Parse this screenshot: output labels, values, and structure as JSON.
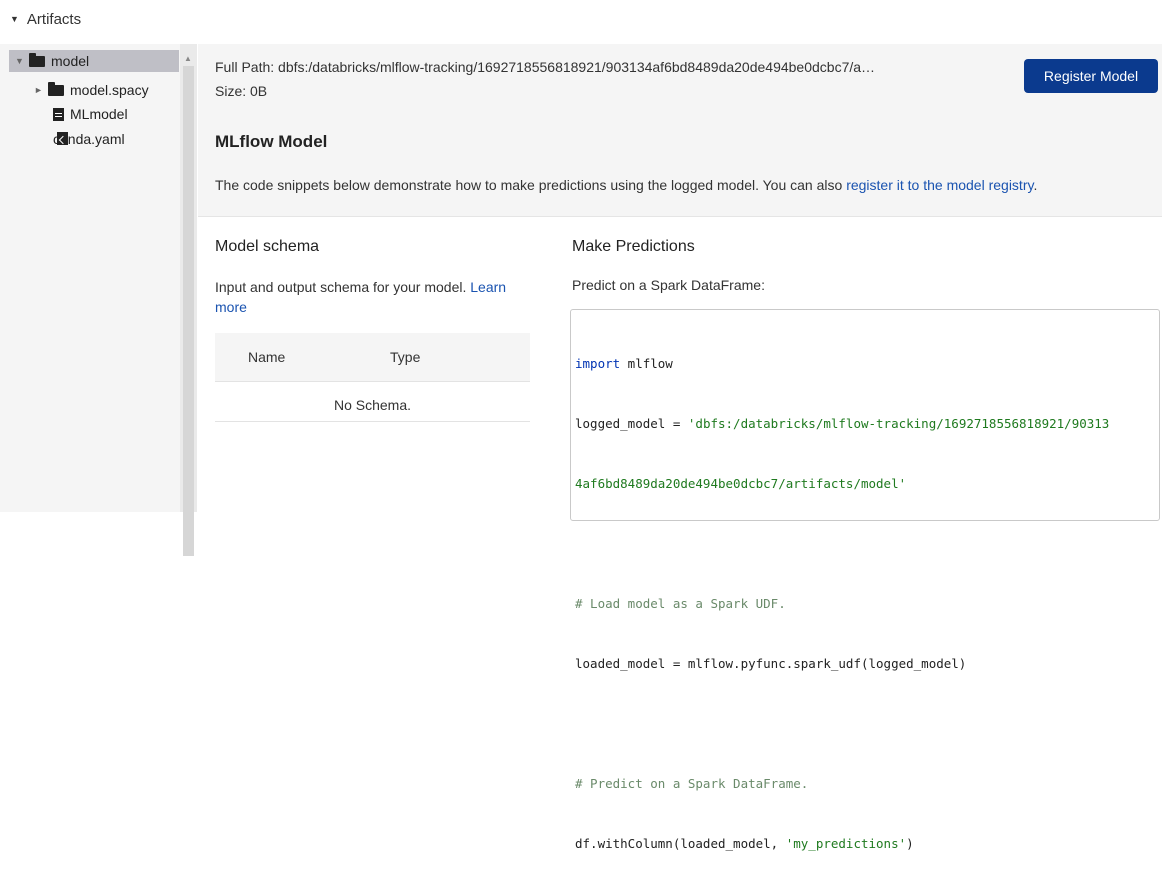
{
  "artifacts": {
    "header_label": "Artifacts"
  },
  "tree": {
    "items": [
      {
        "label": "model",
        "type": "folder",
        "expanded": true,
        "selected": true
      },
      {
        "label": "model.spacy",
        "type": "folder",
        "expanded": false
      },
      {
        "label": "MLmodel",
        "type": "file"
      },
      {
        "label": "conda.yaml",
        "type": "file"
      }
    ]
  },
  "path_bar": {
    "full_path": "Full Path: dbfs:/databricks/mlflow-tracking/1692718556818921/903134af6bd8489da20de494be0dcbc7/a…",
    "size": "Size: 0B",
    "register_button": "Register Model"
  },
  "mlflow_model": {
    "title": "MLflow Model",
    "description": "The code snippets below demonstrate how to make predictions using the logged model. You can also ",
    "link_text": "register it to the model registry",
    "description_end": "."
  },
  "schema": {
    "title": "Model schema",
    "description": "Input and output schema for your model. ",
    "learn_more": "Learn more",
    "columns": [
      "Name",
      "Type"
    ],
    "empty_text": "No Schema."
  },
  "predictions": {
    "title": "Make Predictions",
    "description": "Predict on a Spark DataFrame:",
    "code": {
      "l1_kw": "import",
      "l1_rest": " mlflow",
      "l2_a": "logged_model = ",
      "l2_str": "'dbfs:/databricks/mlflow-tracking/1692718556818921/90313",
      "l3_str": "4af6bd8489da20de494be0dcbc7/artifacts/model'",
      "l5_cmt": "# Load model as a Spark UDF.",
      "l6": "loaded_model = mlflow.pyfunc.spark_udf(logged_model)",
      "l8_cmt": "# Predict on a Spark DataFrame.",
      "l9_a": "df.withColumn(loaded_model, ",
      "l9_str": "'my_predictions'",
      "l9_b": ")"
    }
  },
  "colors": {
    "primary_button": "#0b3a8e",
    "link": "#1a53b0"
  },
  "icons": [
    "caret-down-icon",
    "caret-right-icon",
    "folder-icon",
    "file-icon",
    "code-file-icon",
    "scroll-up-arrow-icon"
  ]
}
